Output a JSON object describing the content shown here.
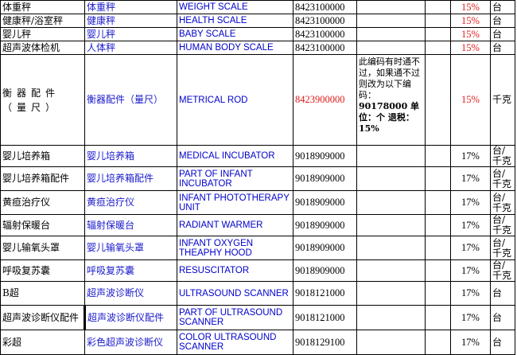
{
  "rows": [
    {
      "item": "体重秤",
      "name": "体重秤",
      "en": "WEIGHT SCALE",
      "code": "8423100000",
      "note": "",
      "c1": "",
      "rate": "15%",
      "unit": "台"
    },
    {
      "item": "健康秤/浴室秤",
      "name": "健康秤",
      "en": "HEALTH SCALE",
      "code": "8423100000",
      "note": "",
      "c1": "",
      "rate": "15%",
      "unit": "台"
    },
    {
      "item": "婴儿秤",
      "name": "婴儿秤",
      "en": "BABY SCALE",
      "code": "8423100000",
      "note": "",
      "c1": "",
      "rate": "15%",
      "unit": "台"
    },
    {
      "item": "超声波体检机",
      "name": "人体秤",
      "en": "HUMAN BODY SCALE",
      "code": "8423100000",
      "note": "",
      "c1": "",
      "rate": "15%",
      "unit": "台"
    },
    {
      "item": "衡器配件（量尺）",
      "name": "衡器配件（量尺）",
      "en": "METRICAL ROD",
      "code": "8423900000",
      "note": "此编码有时通不过，如果通不过则改为以下编码：",
      "note_bold": "90178000 单位：个 退税：15%",
      "c1": "",
      "rate": "15%",
      "unit": "千克"
    },
    {
      "item": "婴儿培养箱",
      "name": "婴儿培养箱",
      "en": "MEDICAL INCUBATOR",
      "code": "9018909000",
      "note": "",
      "c1": "",
      "rate": "17%",
      "unit": "台/千克"
    },
    {
      "item": "婴儿培养箱配件",
      "name": "婴儿培养箱配件",
      "en": "PART OF INFANT INCUBATOR",
      "code": "9018909000",
      "note": "",
      "c1": "",
      "rate": "17%",
      "unit": "台/千克"
    },
    {
      "item": "黄疸治疗仪",
      "name": "黄疸治疗仪",
      "en": "INFANT PHOTOTHERAPY UNIT",
      "code": "9018909000",
      "note": "",
      "c1": "",
      "rate": "17%",
      "unit": "台/千克"
    },
    {
      "item": "辐射保暖台",
      "name": "辐射保暖台",
      "en": "RADIANT WARMER",
      "code": "9018909000",
      "note": "",
      "c1": "",
      "rate": "17%",
      "unit": "台/千克"
    },
    {
      "item": "婴儿输氧头罩",
      "name": "婴儿输氧头罩",
      "en": "INFANT OXYGEN THEAPHY HOOD",
      "code": "9018909000",
      "note": "",
      "c1": "",
      "rate": "17%",
      "unit": "台/千克"
    },
    {
      "item": "呼吸复苏囊",
      "name": "呼吸复苏囊",
      "en": "RESUSCITATOR",
      "code": "9018909000",
      "note": "",
      "c1": "",
      "rate": "17%",
      "unit": "台/千克"
    },
    {
      "item": "B超",
      "name": "超声波诊断仪",
      "en": "ULTRASOUND SCANNER",
      "code": "9018121000",
      "note": "",
      "c1": "",
      "rate": "17%",
      "unit": "台"
    },
    {
      "item": "超声波诊断仪配件",
      "name": "超声波诊断仪配件",
      "en": "PART OF ULTRASOUND SCANNER",
      "code": "9018121000",
      "note": "",
      "c1": "",
      "rate": "17%",
      "unit": "台"
    },
    {
      "item": "彩超",
      "name": "彩色超声波诊断仪",
      "en": "COLOR ULTRASOUND SCANNER",
      "code": "9018129100",
      "note": "",
      "c1": "",
      "rate": "17%",
      "unit": "台"
    }
  ]
}
